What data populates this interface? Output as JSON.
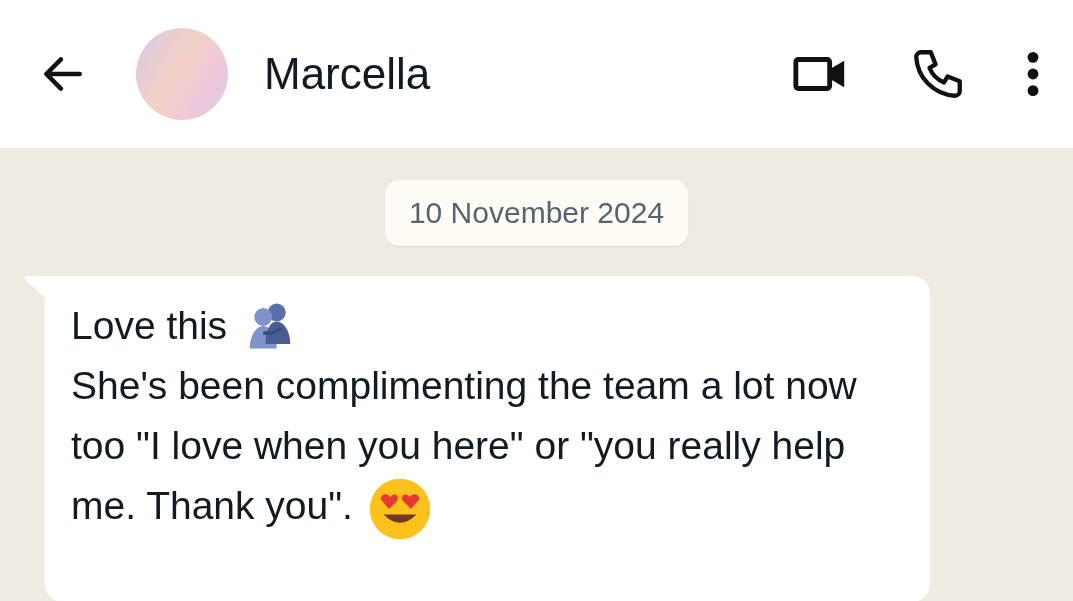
{
  "header": {
    "contact_name": "Marcella"
  },
  "date_chip": "10 November 2024",
  "messages": [
    {
      "first_line": "Love this",
      "body": "She's been complimenting the team a lot now too \"I love when you here\" or \"you really help me. Thank you\"."
    }
  ]
}
